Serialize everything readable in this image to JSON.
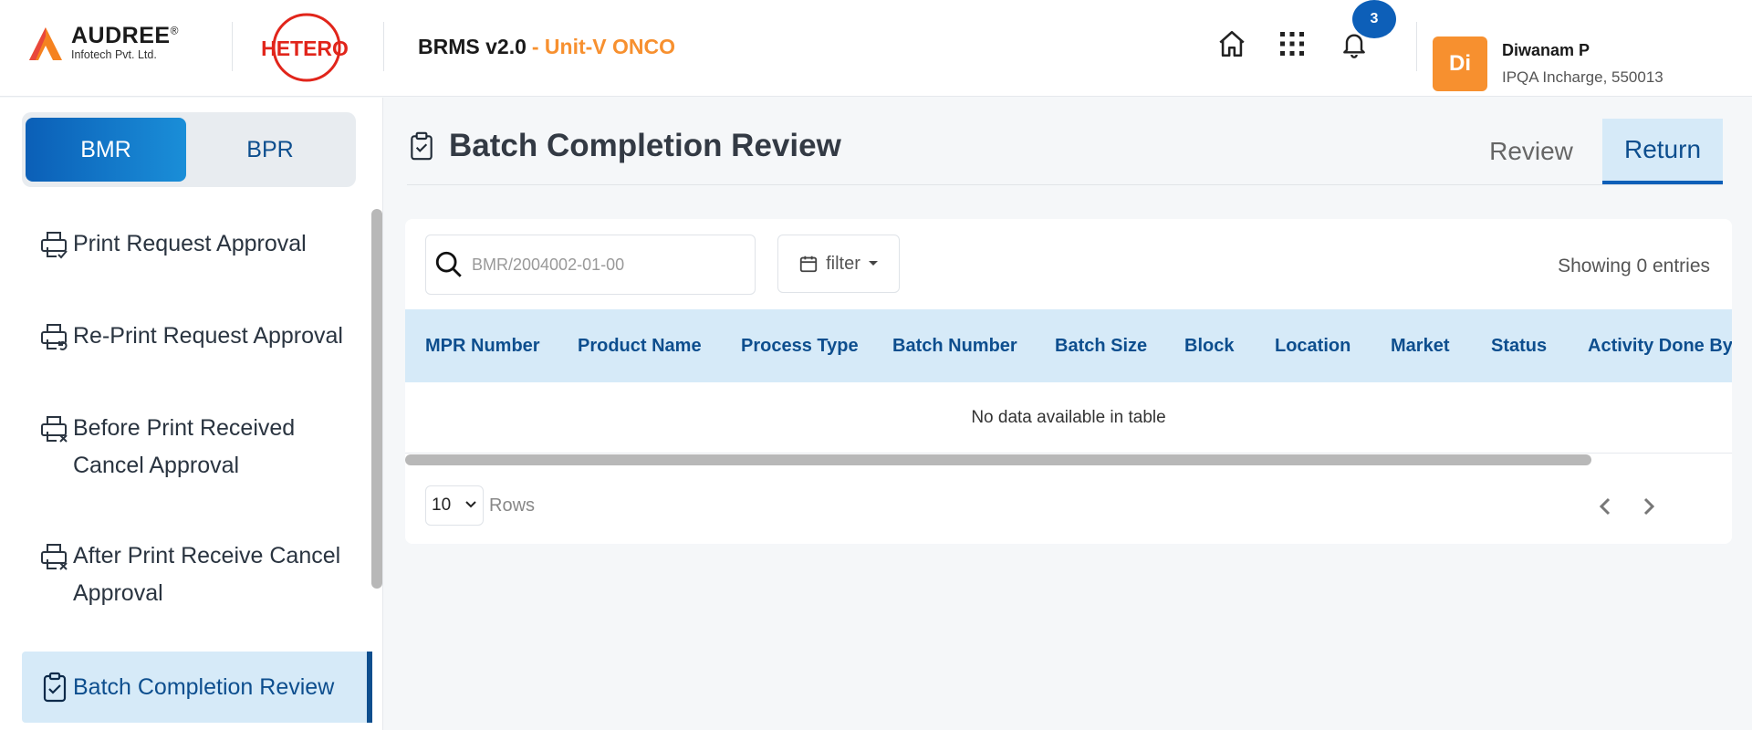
{
  "header": {
    "company_logo": {
      "brand": "AUDREE",
      "reg_mark": "®",
      "subtitle": "Infotech Pvt. Ltd."
    },
    "client_logo": "HETERO",
    "app_name": "BRMS v2.0",
    "unit": "- Unit-V ONCO",
    "notifications_count": "3",
    "icons": [
      "home-icon",
      "apps-grid-icon",
      "bell-icon"
    ],
    "user": {
      "initials": "Di",
      "name": "Diwanam P",
      "role": "IPQA Incharge, 550013"
    },
    "colors": {
      "accent": "#0d5fb8",
      "orange": "#f7902f"
    }
  },
  "sidebar": {
    "toggle": {
      "active": "BMR",
      "inactive": "BPR"
    },
    "items": [
      {
        "label": "Print Request Approval",
        "icon": "printer-check-icon"
      },
      {
        "label": "Re-Print Request Approval",
        "icon": "printer-refresh-icon"
      },
      {
        "label": "Before Print Received Cancel Approval",
        "icon": "printer-cancel-icon"
      },
      {
        "label": "After Print Receive Cancel Approval",
        "icon": "printer-cancel-icon"
      },
      {
        "label": "Batch Completion Review",
        "icon": "clipboard-check-icon",
        "active": true
      }
    ]
  },
  "main": {
    "title": "Batch Completion Review",
    "tabs": [
      {
        "label": "Review",
        "active": false
      },
      {
        "label": "Return",
        "active": true
      }
    ],
    "search": {
      "placeholder": "BMR/2004002-01-00",
      "value": ""
    },
    "filter_label": "filter",
    "entries_text": "Showing 0 entries",
    "table": {
      "columns": [
        "MPR Number",
        "Product Name",
        "Process Type",
        "Batch Number",
        "Batch Size",
        "Block",
        "Location",
        "Market",
        "Status",
        "Activity Done By"
      ],
      "empty_text": "No data available in table"
    },
    "pagination": {
      "rows_value": "10",
      "rows_label": "Rows"
    }
  }
}
